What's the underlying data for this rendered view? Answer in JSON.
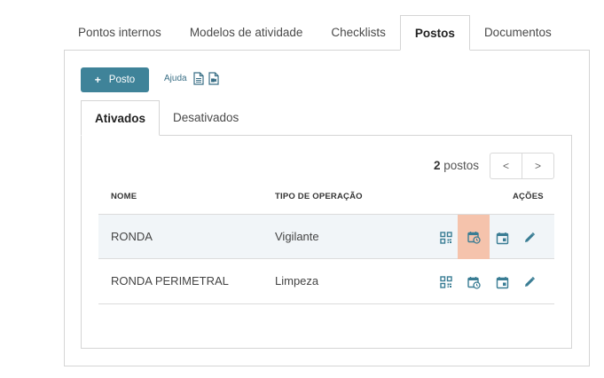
{
  "tabs": [
    "Pontos internos",
    "Modelos de atividade",
    "Checklists",
    "Postos",
    "Documentos"
  ],
  "active_tab": "Postos",
  "toolbar": {
    "add_label": "Posto",
    "help_label": "Ajuda"
  },
  "sub_tabs": [
    "Ativados",
    "Desativados"
  ],
  "active_sub_tab": "Ativados",
  "summary": {
    "count": "2",
    "unit": "postos"
  },
  "pager": {
    "prev": "<",
    "next": ">"
  },
  "table": {
    "headers": {
      "name": "NOME",
      "type": "TIPO DE OPERAÇÃO",
      "actions": "AÇÕES"
    },
    "rows": [
      {
        "name": "RONDA",
        "type": "Vigilante"
      },
      {
        "name": "RONDA PERIMETRAL",
        "type": "Limpeza"
      }
    ]
  },
  "icons": [
    "qr-code-icon",
    "schedule-icon",
    "calendar-icon",
    "pencil-icon"
  ],
  "colors": {
    "accent": "#3f8399",
    "icon": "#3a7d94",
    "highlight": "#f5c3ac",
    "row_hover": "#f1f5f8"
  }
}
